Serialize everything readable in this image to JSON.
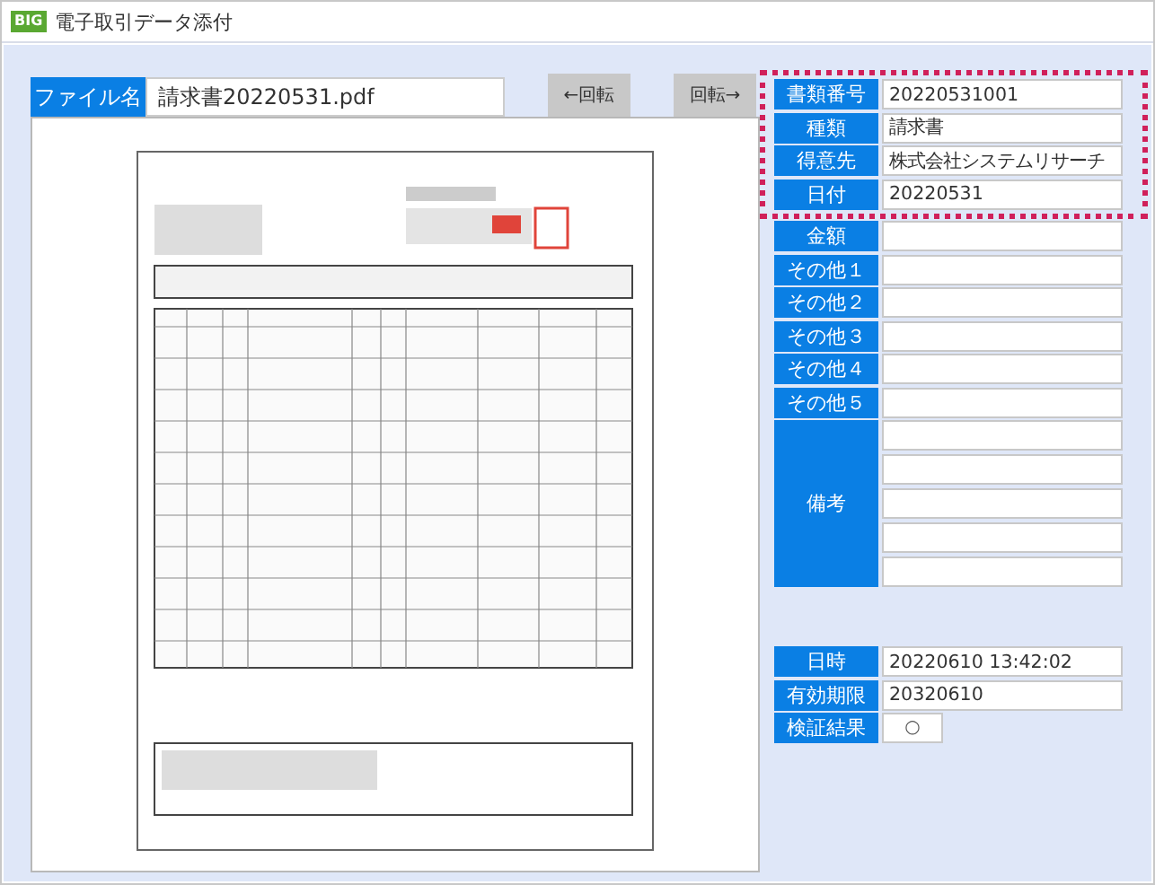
{
  "window": {
    "title": "電子取引データ添付",
    "logo": "BIG"
  },
  "file": {
    "label": "ファイル名",
    "name": "請求書20220531.pdf"
  },
  "rotate_buttons": [
    "←回転",
    "回転→"
  ],
  "highlighted_fields": [
    {
      "label": "書類番号",
      "value": "20220531001"
    },
    {
      "label": "種類",
      "value": "請求書"
    },
    {
      "label": "得意先",
      "value": "株式会社システムリサーチ"
    },
    {
      "label": "日付",
      "value": "20220531"
    }
  ],
  "fields": [
    {
      "label": "金額"
    },
    {
      "label": "その他１"
    },
    {
      "label": "その他２"
    },
    {
      "label": "その他３"
    },
    {
      "label": "その他４"
    },
    {
      "label": "その他５"
    }
  ],
  "remarks": {
    "label": "備考"
  },
  "stamp_fields": [
    {
      "label": "日時",
      "value": "20220610 13:42:02"
    },
    {
      "label": "有効期限",
      "value": "20320610"
    }
  ],
  "verification": {
    "label": "検証結果",
    "value": "○"
  }
}
